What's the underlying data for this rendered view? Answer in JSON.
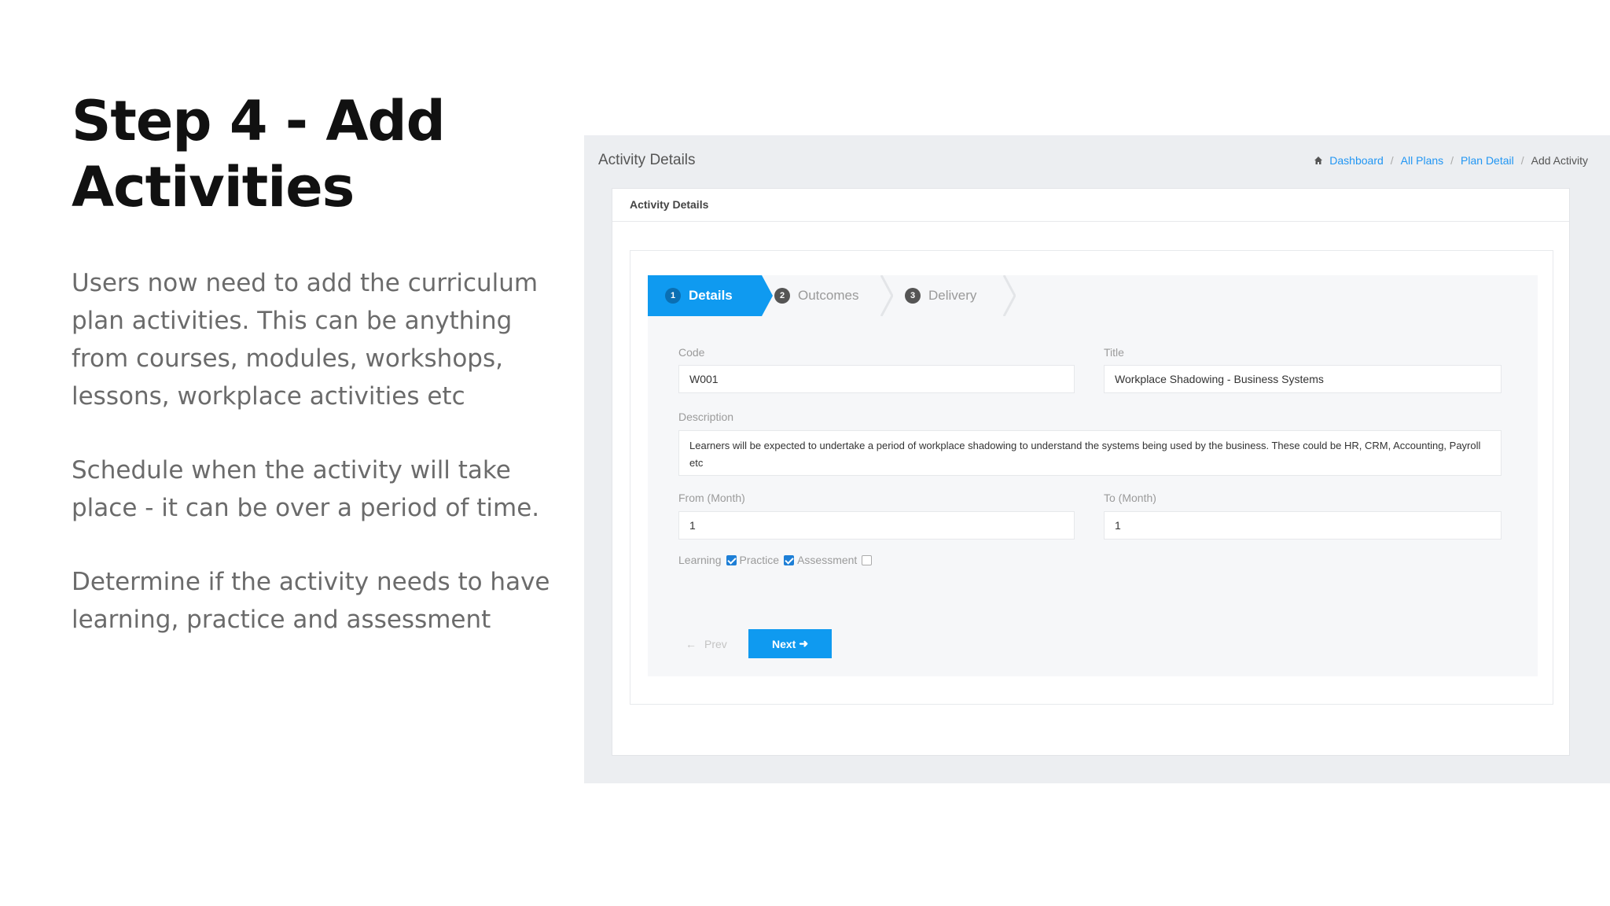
{
  "slide": {
    "title_line1": "Step 4 - Add",
    "title_line2": "Activities",
    "para1": "Users now need to add the curriculum plan activities. This can be anything from courses, modules, workshops, lessons, workplace activities etc",
    "para2": "Schedule when the activity will take place - it can be over a period of time.",
    "para3": "Determine if the activity needs to have learning, practice and assessment"
  },
  "app": {
    "page_title": "Activity Details",
    "breadcrumb": [
      "Dashboard",
      "All Plans",
      "Plan Detail",
      "Add Activity"
    ],
    "card_title": "Activity Details",
    "steps": [
      {
        "num": "1",
        "label": "Details",
        "active": true
      },
      {
        "num": "2",
        "label": "Outcomes",
        "active": false
      },
      {
        "num": "3",
        "label": "Delivery",
        "active": false
      }
    ],
    "form": {
      "code_label": "Code",
      "code_value": "W001",
      "title_label": "Title",
      "title_value": "Workplace Shadowing - Business Systems",
      "description_label": "Description",
      "description_value": "Learners will be expected to undertake a period of workplace shadowing to understand the systems being used by the business. These could be HR, CRM, Accounting, Payroll etc",
      "from_label": "From (Month)",
      "from_value": "1",
      "to_label": "To (Month)",
      "to_value": "1",
      "checkboxes": [
        {
          "label": "Learning",
          "checked": true
        },
        {
          "label": "Practice",
          "checked": true
        },
        {
          "label": "Assessment",
          "checked": false
        }
      ]
    },
    "buttons": {
      "prev_label": "Prev",
      "next_label": "Next"
    },
    "colors": {
      "accent": "#0f9af0",
      "link": "#2196f3"
    }
  }
}
